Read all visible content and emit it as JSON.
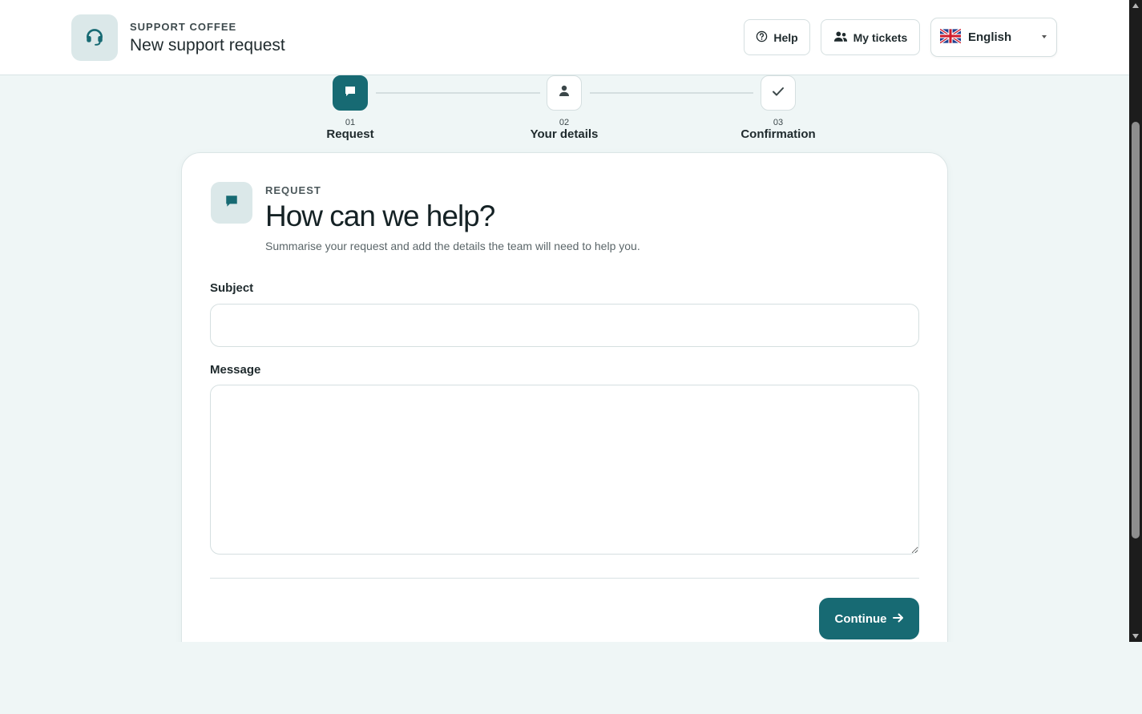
{
  "header": {
    "eyebrow": "SUPPORT COFFEE",
    "title": "New support request",
    "help_label": "Help",
    "tickets_label": "My tickets",
    "language": "English"
  },
  "steps": [
    {
      "num": "01",
      "label": "Request",
      "icon": "chat-icon",
      "active": true
    },
    {
      "num": "02",
      "label": "Your details",
      "icon": "user-icon",
      "active": false
    },
    {
      "num": "03",
      "label": "Confirmation",
      "icon": "check-icon",
      "active": false
    }
  ],
  "card": {
    "eyebrow": "REQUEST",
    "title": "How can we help?",
    "subtitle": "Summarise your request and add the details the team will need to help you.",
    "subject_label": "Subject",
    "subject_value": "",
    "message_label": "Message",
    "message_value": "",
    "continue_label": "Continue"
  },
  "colors": {
    "accent": "#176a73",
    "background": "#eff6f6",
    "tile": "#dbe8e9"
  }
}
